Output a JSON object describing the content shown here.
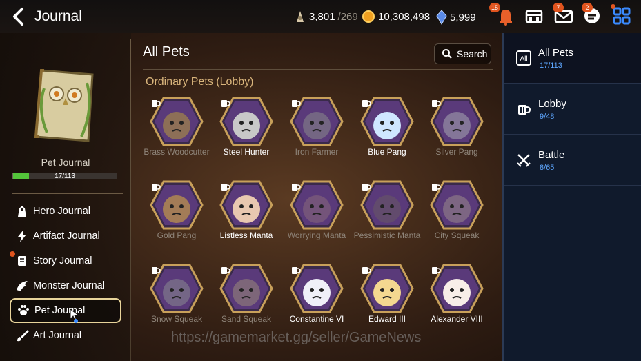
{
  "header": {
    "title": "Journal",
    "resources": [
      {
        "icon": "stamina-icon",
        "value": "3,801",
        "sub": "/269"
      },
      {
        "icon": "gold-coin-icon",
        "value": "10,308,498",
        "sub": ""
      },
      {
        "icon": "crystal-icon",
        "value": "5,999",
        "sub": ""
      }
    ],
    "badges": {
      "notifications": "15",
      "mail": "7",
      "chat": "2"
    }
  },
  "left": {
    "journal_label": "Pet Journal",
    "progress_text": "17/113",
    "progress": 0.15,
    "menu": [
      {
        "label": "Hero Journal",
        "icon": "hero-icon"
      },
      {
        "label": "Artifact Journal",
        "icon": "artifact-icon"
      },
      {
        "label": "Story Journal",
        "icon": "scroll-icon"
      },
      {
        "label": "Monster Journal",
        "icon": "monster-icon"
      },
      {
        "label": "Pet Journal",
        "icon": "paw-icon"
      },
      {
        "label": "Art Journal",
        "icon": "brush-icon"
      }
    ]
  },
  "main": {
    "title": "All Pets",
    "search_label": "Search",
    "section": "Ordinary Pets (Lobby)",
    "pets": [
      {
        "name": "Brass Woodcutter",
        "owned": false,
        "color": "#b89a3a"
      },
      {
        "name": "Steel Hunter",
        "owned": true,
        "color": "#c8c8c8"
      },
      {
        "name": "Iron Farmer",
        "owned": false,
        "color": "#8a8a8a"
      },
      {
        "name": "Blue Pang",
        "owned": true,
        "color": "#cfe6ff"
      },
      {
        "name": "Silver Pang",
        "owned": false,
        "color": "#a8a8b0"
      },
      {
        "name": "Gold Pang",
        "owned": false,
        "color": "#e0b23a"
      },
      {
        "name": "Listless Manta",
        "owned": true,
        "color": "#e8c8b0"
      },
      {
        "name": "Worrying Manta",
        "owned": false,
        "color": "#8a6a7a"
      },
      {
        "name": "Pessimistic Manta",
        "owned": false,
        "color": "#6a5a62"
      },
      {
        "name": "City Squeak",
        "owned": false,
        "color": "#9a8a8a"
      },
      {
        "name": "Snow Squeak",
        "owned": false,
        "color": "#8a8a90"
      },
      {
        "name": "Sand Squeak",
        "owned": false,
        "color": "#9a8a78"
      },
      {
        "name": "Constantine VI",
        "owned": true,
        "color": "#f0f0f8"
      },
      {
        "name": "Edward III",
        "owned": true,
        "color": "#f4d890"
      },
      {
        "name": "Alexander VIII",
        "owned": true,
        "color": "#f8eee8"
      }
    ],
    "watermark": "https://gamemarket.gg/seller/GameNews"
  },
  "right": {
    "tabs": [
      {
        "label": "All Pets",
        "count": "17/113",
        "icon": "all-icon",
        "active": true
      },
      {
        "label": "Lobby",
        "count": "9/48",
        "icon": "mug-icon",
        "active": false
      },
      {
        "label": "Battle",
        "count": "8/65",
        "icon": "crossed-swords-icon",
        "active": false
      }
    ]
  },
  "colors": {
    "accent_green": "#53c43a",
    "count_blue": "#5ea7ff",
    "section_gold": "#d9b57c",
    "badge_orange": "#e0541e"
  }
}
